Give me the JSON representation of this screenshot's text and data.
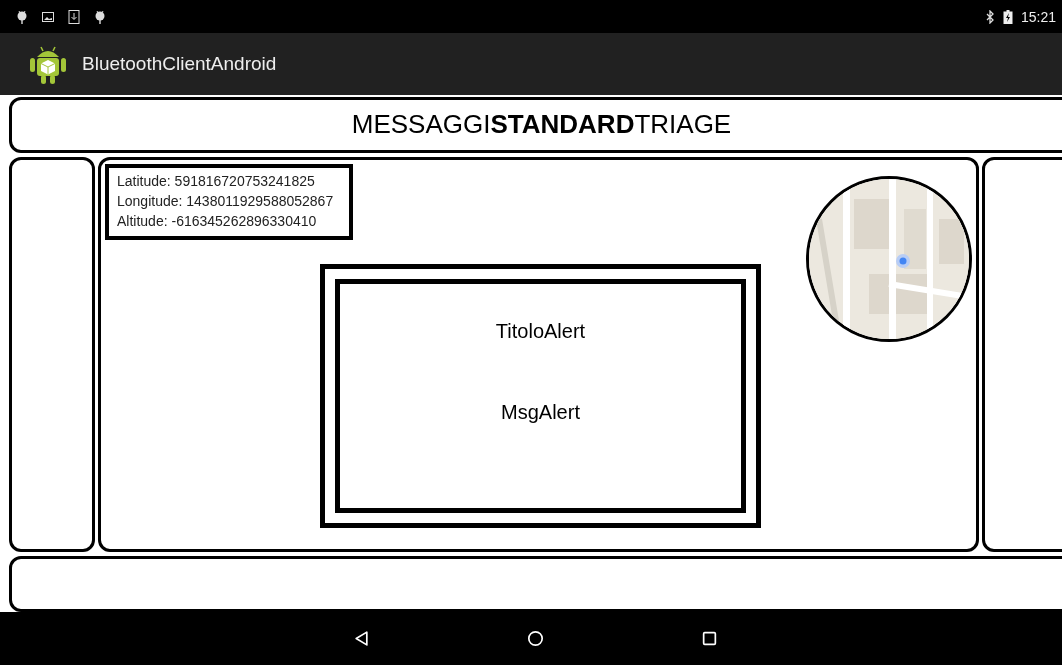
{
  "status_bar": {
    "time": "15:21"
  },
  "app_bar": {
    "title": "BluetoothClientAndroid"
  },
  "header": {
    "title": "MESSAGGI**STANDARD**TRIAGE"
  },
  "coordinates": [
    "Latitude: 591816720753241825",
    "Longitude: 1438011929588052867",
    "Altitude: -616345262896330410"
  ],
  "alert": {
    "title": "TitoloAlert",
    "message": "MsgAlert"
  }
}
